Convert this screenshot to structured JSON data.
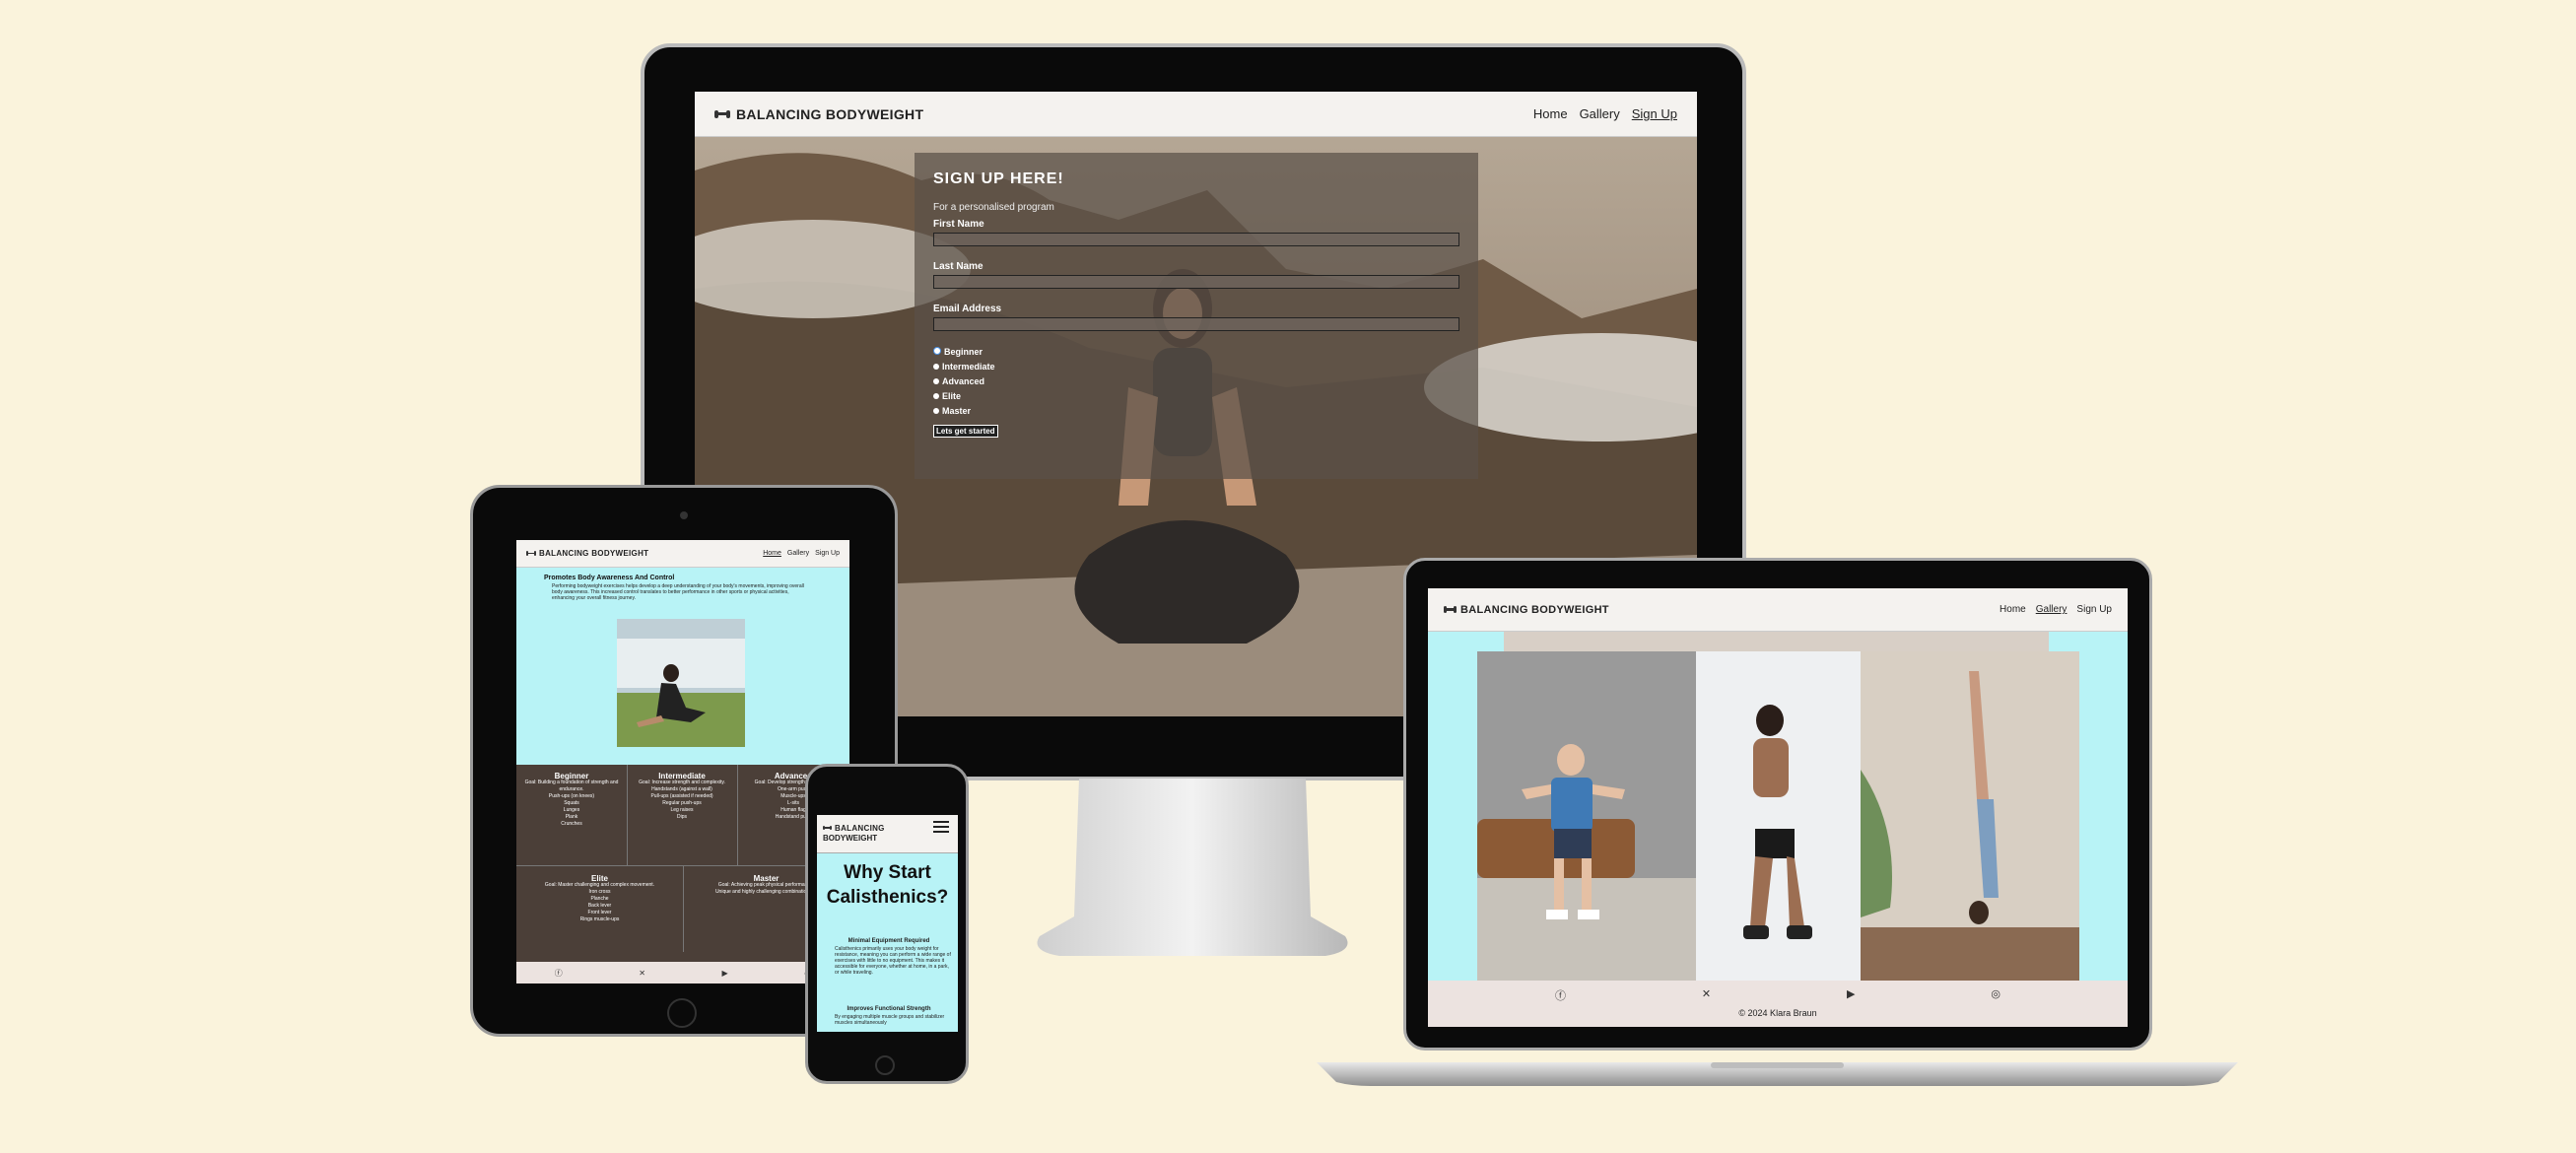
{
  "brand": {
    "name": "BALANCING BODYWEIGHT"
  },
  "nav": {
    "home": "Home",
    "gallery": "Gallery",
    "signup": "Sign Up"
  },
  "monitor": {
    "form_title": "SIGN UP HERE!",
    "form_subtitle": "For a personalised program",
    "first_name_label": "First Name",
    "last_name_label": "Last Name",
    "email_label": "Email Address",
    "levels": [
      "Beginner",
      "Intermediate",
      "Advanced",
      "Elite",
      "Master"
    ],
    "selected_level": "Beginner",
    "submit_label": "Lets get started"
  },
  "tablet": {
    "heading": "Promotes Body Awareness And Control",
    "body": "Performing bodyweight exercises helps develop a deep understanding of your body's movements, improving overall body awareness. This increased control translates to better performance in other sports or physical activities, enhancing your overall fitness journey.",
    "levels": [
      {
        "title": "Beginner",
        "goal": "Goal: Building a foundation of strength and endurance.",
        "items": [
          "Push-ups (on knees)",
          "Squats",
          "Lunges",
          "Plank",
          "Crunches"
        ]
      },
      {
        "title": "Intermediate",
        "goal": "Goal: Increase strength and complexity.",
        "items": [
          "Handstands (against a wall)",
          "Pull-ups (assisted if needed)",
          "Regular push-ups",
          "Leg raises",
          "Dips"
        ]
      },
      {
        "title": "Advanced",
        "goal": "Goal: Develop strength and control.",
        "items": [
          "One-arm push",
          "Muscle-ups",
          "L-sits",
          "Human flag",
          "Handstand push"
        ]
      },
      {
        "title": "Elite",
        "goal": "Goal: Master challenging and complex movement.",
        "items": [
          "Iron cross",
          "Planche",
          "Back lever",
          "Front lever",
          "Rings muscle-ups"
        ]
      },
      {
        "title": "Master",
        "goal": "Goal: Achieving peak physical performance.",
        "items": [
          "Unique and highly challenging combinations of"
        ]
      }
    ],
    "footer_icons": [
      "facebook-icon",
      "x-icon",
      "youtube-icon",
      "instagram-icon"
    ]
  },
  "phone": {
    "brand_line1": "BALANCING",
    "brand_line2": "BODYWEIGHT",
    "title": "Why Start Calisthenics?",
    "section1_heading": "Minimal Equipment Required",
    "section1_body": "Calisthenics primarily uses your body weight for resistance, meaning you can perform a wide range of exercises with little to no equipment. This makes it accessible for everyone, whether at home, in a park, or while traveling.",
    "section2_heading": "Improves Functional Strength",
    "section2_body": "By engaging multiple muscle groups and stabilizer muscles simultaneously"
  },
  "laptop": {
    "footer_text": "© 2024 Klara Braun",
    "footer_icons": [
      "facebook-icon",
      "x-icon",
      "youtube-icon",
      "instagram-icon"
    ]
  },
  "colors": {
    "background": "#faf3dc",
    "accent": "#b8f3f6",
    "nav": "#f4f2ef",
    "footer": "#ece3e0"
  }
}
